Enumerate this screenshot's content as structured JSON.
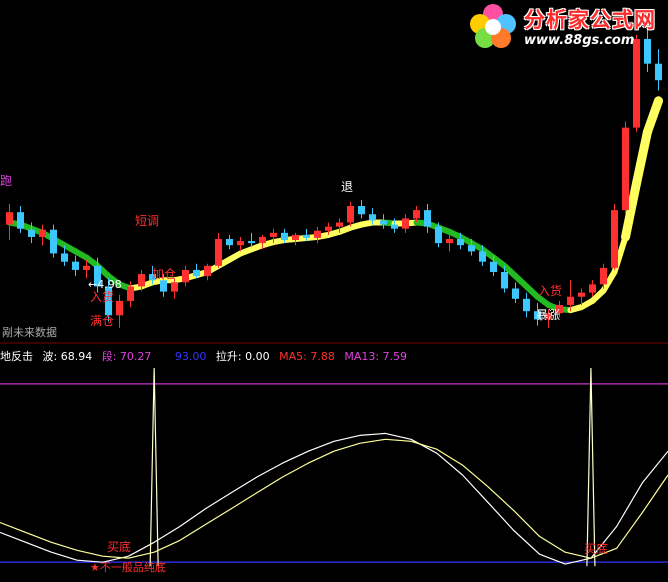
{
  "branding": {
    "site_name": "分析家公式网",
    "site_url": "www.88gs.com"
  },
  "upper_annotations": {
    "run": "跑",
    "short_adjust": "短调",
    "exit": "退",
    "price_marker": "←4.98",
    "in_stock_left": "入货",
    "add_position": "加仓",
    "full_position": "满仓",
    "in_stock_right": "入货",
    "surge": "暴涨",
    "no_future_data": "剐未来数据"
  },
  "indicator_bar": {
    "name": "地反击",
    "wave": "波: 68.94",
    "segment": "段: 70.27",
    "blue_value": "93.00",
    "pull_up": "拉升: 0.00",
    "ma5": "MA5: 7.88",
    "ma13": "MA13: 7.59"
  },
  "lower_annotations": {
    "buy_bottom_left": "买底",
    "buy_bottom_right": "买底",
    "star_note": "★不一般品纯底"
  },
  "colors": {
    "bull": "#ff3030",
    "bear": "#3cc8ff",
    "ribbon_yellow": "#ffff60",
    "ribbon_green": "#22bb22",
    "wave": "#ffffff",
    "segment": "#ffff99",
    "line_blue": "#3333ff",
    "line_magenta": "#cc33cc"
  },
  "chart_data": [
    {
      "type": "candlestick",
      "title": "",
      "candles": [
        [
          8.1,
          8.3,
          7.95,
          8.22
        ],
        [
          8.22,
          8.28,
          8.02,
          8.06
        ],
        [
          8.05,
          8.12,
          7.92,
          7.98
        ],
        [
          7.98,
          8.1,
          7.9,
          8.05
        ],
        [
          8.05,
          8.1,
          7.78,
          7.82
        ],
        [
          7.82,
          7.9,
          7.7,
          7.74
        ],
        [
          7.74,
          7.8,
          7.6,
          7.66
        ],
        [
          7.66,
          7.76,
          7.58,
          7.7
        ],
        [
          7.7,
          7.78,
          7.44,
          7.5
        ],
        [
          7.5,
          7.58,
          7.16,
          7.22
        ],
        [
          7.22,
          7.42,
          7.1,
          7.36
        ],
        [
          7.36,
          7.55,
          7.3,
          7.5
        ],
        [
          7.5,
          7.66,
          7.46,
          7.62
        ],
        [
          7.62,
          7.7,
          7.52,
          7.56
        ],
        [
          7.56,
          7.62,
          7.4,
          7.45
        ],
        [
          7.45,
          7.58,
          7.38,
          7.54
        ],
        [
          7.54,
          7.7,
          7.5,
          7.66
        ],
        [
          7.66,
          7.72,
          7.58,
          7.6
        ],
        [
          7.6,
          7.72,
          7.56,
          7.7
        ],
        [
          7.7,
          8.02,
          7.68,
          7.96
        ],
        [
          7.96,
          8.0,
          7.86,
          7.9
        ],
        [
          7.9,
          7.98,
          7.84,
          7.94
        ],
        [
          7.94,
          8.02,
          7.88,
          7.92
        ],
        [
          7.92,
          8.0,
          7.86,
          7.98
        ],
        [
          7.98,
          8.06,
          7.92,
          8.02
        ],
        [
          8.02,
          8.06,
          7.92,
          7.95
        ],
        [
          7.95,
          8.02,
          7.9,
          8.0
        ],
        [
          8.0,
          8.06,
          7.94,
          7.97
        ],
        [
          7.97,
          8.08,
          7.92,
          8.04
        ],
        [
          8.04,
          8.12,
          8.0,
          8.08
        ],
        [
          8.08,
          8.16,
          8.02,
          8.12
        ],
        [
          8.12,
          8.32,
          8.08,
          8.28
        ],
        [
          8.28,
          8.34,
          8.16,
          8.2
        ],
        [
          8.2,
          8.26,
          8.1,
          8.14
        ],
        [
          8.14,
          8.2,
          8.06,
          8.1
        ],
        [
          8.1,
          8.16,
          8.02,
          8.06
        ],
        [
          8.06,
          8.2,
          8.02,
          8.16
        ],
        [
          8.16,
          8.28,
          8.12,
          8.24
        ],
        [
          8.24,
          8.3,
          8.02,
          8.08
        ],
        [
          8.08,
          8.12,
          7.88,
          7.92
        ],
        [
          7.92,
          8.0,
          7.84,
          7.96
        ],
        [
          7.96,
          8.02,
          7.86,
          7.9
        ],
        [
          7.9,
          7.96,
          7.8,
          7.84
        ],
        [
          7.84,
          7.9,
          7.7,
          7.74
        ],
        [
          7.74,
          7.8,
          7.6,
          7.64
        ],
        [
          7.64,
          7.7,
          7.44,
          7.48
        ],
        [
          7.48,
          7.54,
          7.34,
          7.38
        ],
        [
          7.38,
          7.44,
          7.2,
          7.26
        ],
        [
          7.26,
          7.34,
          7.12,
          7.18
        ],
        [
          7.18,
          7.28,
          7.1,
          7.24
        ],
        [
          7.24,
          7.36,
          7.2,
          7.32
        ],
        [
          7.32,
          7.56,
          7.26,
          7.4
        ],
        [
          7.4,
          7.48,
          7.32,
          7.44
        ],
        [
          7.44,
          7.56,
          7.4,
          7.52
        ],
        [
          7.52,
          7.72,
          7.48,
          7.68
        ],
        [
          7.68,
          8.3,
          7.66,
          8.24
        ],
        [
          8.24,
          9.1,
          8.2,
          9.04
        ],
        [
          9.04,
          9.94,
          9.0,
          9.9
        ],
        [
          9.9,
          10.0,
          9.58,
          9.66
        ],
        [
          9.66,
          9.8,
          9.4,
          9.5
        ]
      ],
      "ma_ribbon": [
        8.12,
        8.1,
        8.06,
        8.02,
        7.96,
        7.9,
        7.84,
        7.78,
        7.7,
        7.6,
        7.52,
        7.48,
        7.5,
        7.54,
        7.56,
        7.56,
        7.58,
        7.61,
        7.64,
        7.7,
        7.76,
        7.82,
        7.86,
        7.9,
        7.93,
        7.95,
        7.96,
        7.97,
        7.98,
        8.0,
        8.03,
        8.07,
        8.1,
        8.12,
        8.12,
        8.11,
        8.11,
        8.12,
        8.11,
        8.07,
        8.03,
        7.98,
        7.92,
        7.86,
        7.78,
        7.7,
        7.6,
        7.5,
        7.4,
        7.32,
        7.28,
        7.27,
        7.3,
        7.36,
        7.46,
        7.64,
        7.98,
        8.5,
        9.0,
        9.3
      ],
      "ylim": [
        7.0,
        10.2
      ]
    },
    {
      "type": "line",
      "title": "",
      "series": [
        {
          "name": "波",
          "values": [
            17,
            12,
            7,
            3,
            2,
            5,
            12,
            20,
            29,
            37,
            45,
            52,
            58,
            63,
            66,
            67,
            64,
            57,
            46,
            32,
            18,
            6,
            1,
            4,
            20,
            42,
            58
          ]
        },
        {
          "name": "段",
          "values": [
            22,
            17,
            12,
            8,
            5,
            4,
            7,
            13,
            21,
            29,
            37,
            45,
            52,
            58,
            62,
            64,
            63,
            59,
            51,
            40,
            28,
            15,
            7,
            4,
            9,
            27,
            46
          ]
        }
      ],
      "spikes": [
        {
          "index": 6,
          "value": 100
        },
        {
          "index": 23,
          "value": 100
        }
      ],
      "reference_lines": [
        {
          "color": "magenta",
          "value": 92
        },
        {
          "color": "blue",
          "value": 2
        }
      ],
      "ylim": [
        -6,
        100
      ]
    }
  ]
}
